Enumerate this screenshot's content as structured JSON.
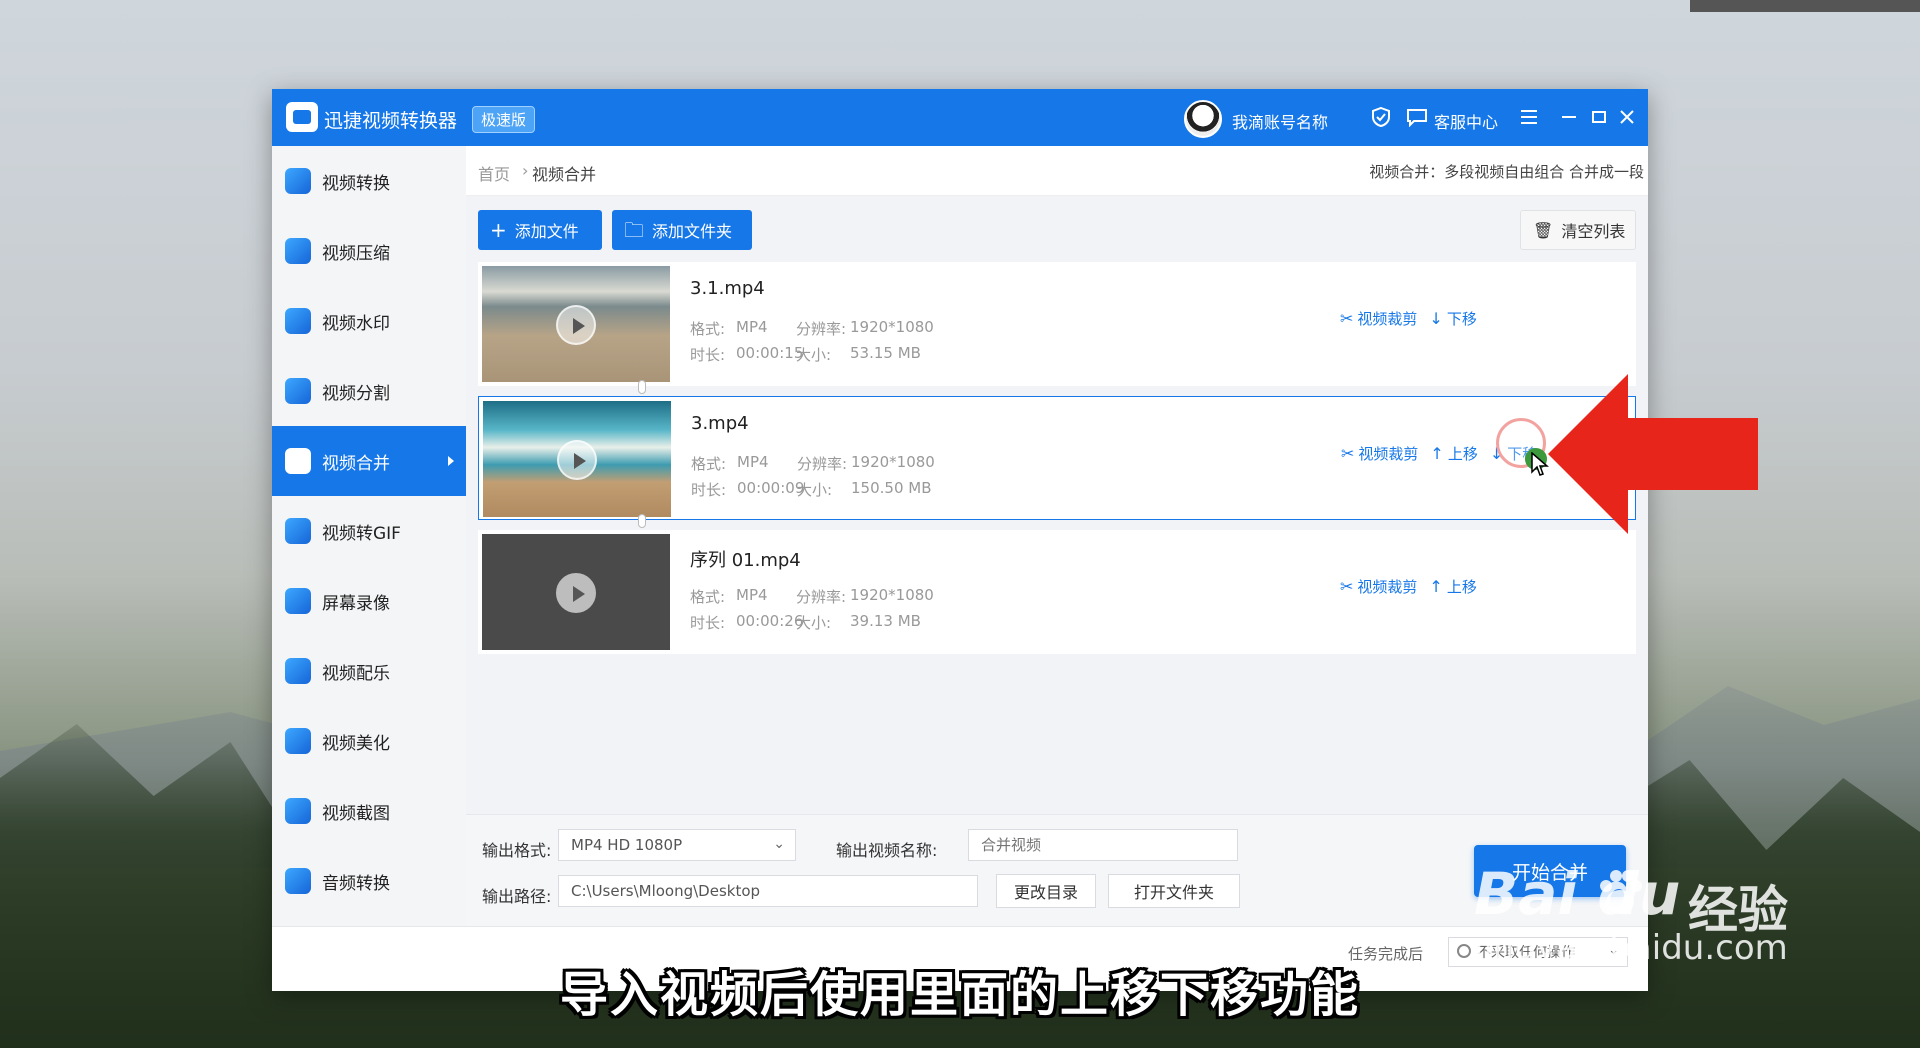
{
  "app": {
    "title": "迅捷视频转换器",
    "badge": "极速版",
    "account": "我滴账号名称",
    "service": "客服中心"
  },
  "sidebar": {
    "items": [
      {
        "label": "视频转换",
        "icon": "video-convert-icon"
      },
      {
        "label": "视频压缩",
        "icon": "video-compress-icon"
      },
      {
        "label": "视频水印",
        "icon": "video-watermark-icon"
      },
      {
        "label": "视频分割",
        "icon": "video-split-icon"
      },
      {
        "label": "视频合并",
        "icon": "video-merge-icon",
        "active": true
      },
      {
        "label": "视频转GIF",
        "icon": "gif-icon"
      },
      {
        "label": "屏幕录像",
        "icon": "screen-record-icon"
      },
      {
        "label": "视频配乐",
        "icon": "music-icon"
      },
      {
        "label": "视频美化",
        "icon": "beautify-icon"
      },
      {
        "label": "视频截图",
        "icon": "screenshot-icon"
      },
      {
        "label": "音频转换",
        "icon": "audio-convert-icon"
      }
    ]
  },
  "breadcrumb": {
    "home": "首页",
    "separator": "›",
    "current": "视频合并"
  },
  "hint": "视频合并：多段视频自由组合 合并成一段",
  "toolbar": {
    "add_file": "添加文件",
    "add_folder": "添加文件夹",
    "clear_list": "清空列表"
  },
  "meta_labels": {
    "format": "格式:",
    "resolution": "分辨率:",
    "duration": "时长:",
    "size": "大小:"
  },
  "files": [
    {
      "name": "3.1.mp4",
      "format": "MP4",
      "resolution": "1920*1080",
      "duration": "00:00:15",
      "size": "53.15 MB",
      "actions": {
        "trim": "视频裁剪",
        "down": "下移"
      }
    },
    {
      "name": "3.mp4",
      "format": "MP4",
      "resolution": "1920*1080",
      "duration": "00:00:09",
      "size": "150.50 MB",
      "actions": {
        "trim": "视频裁剪",
        "up": "上移",
        "down": "下移"
      }
    },
    {
      "name": "序列 01.mp4",
      "format": "MP4",
      "resolution": "1920*1080",
      "duration": "00:00:26",
      "size": "39.13 MB",
      "actions": {
        "trim": "视频裁剪",
        "up": "上移"
      }
    }
  ],
  "output": {
    "format_label": "输出格式:",
    "format_value": "MP4   HD 1080P",
    "name_label": "输出视频名称:",
    "name_placeholder": "合并视频",
    "path_label": "输出路径:",
    "path_value": "C:\\Users\\Mloong\\Desktop",
    "change_dir": "更改目录",
    "open_folder": "打开文件夹",
    "start": "开始合并"
  },
  "footer": {
    "task_label": "任务完成后",
    "task_value": "不采取任何操作"
  },
  "overlay": {
    "subtitle": "导入视频后使用里面的上移下移功能",
    "watermark_logo": "Bai du",
    "watermark_cn": "经验",
    "watermark_url": "jingyan.baidu.com",
    "arrow_color": "#e8251a"
  }
}
